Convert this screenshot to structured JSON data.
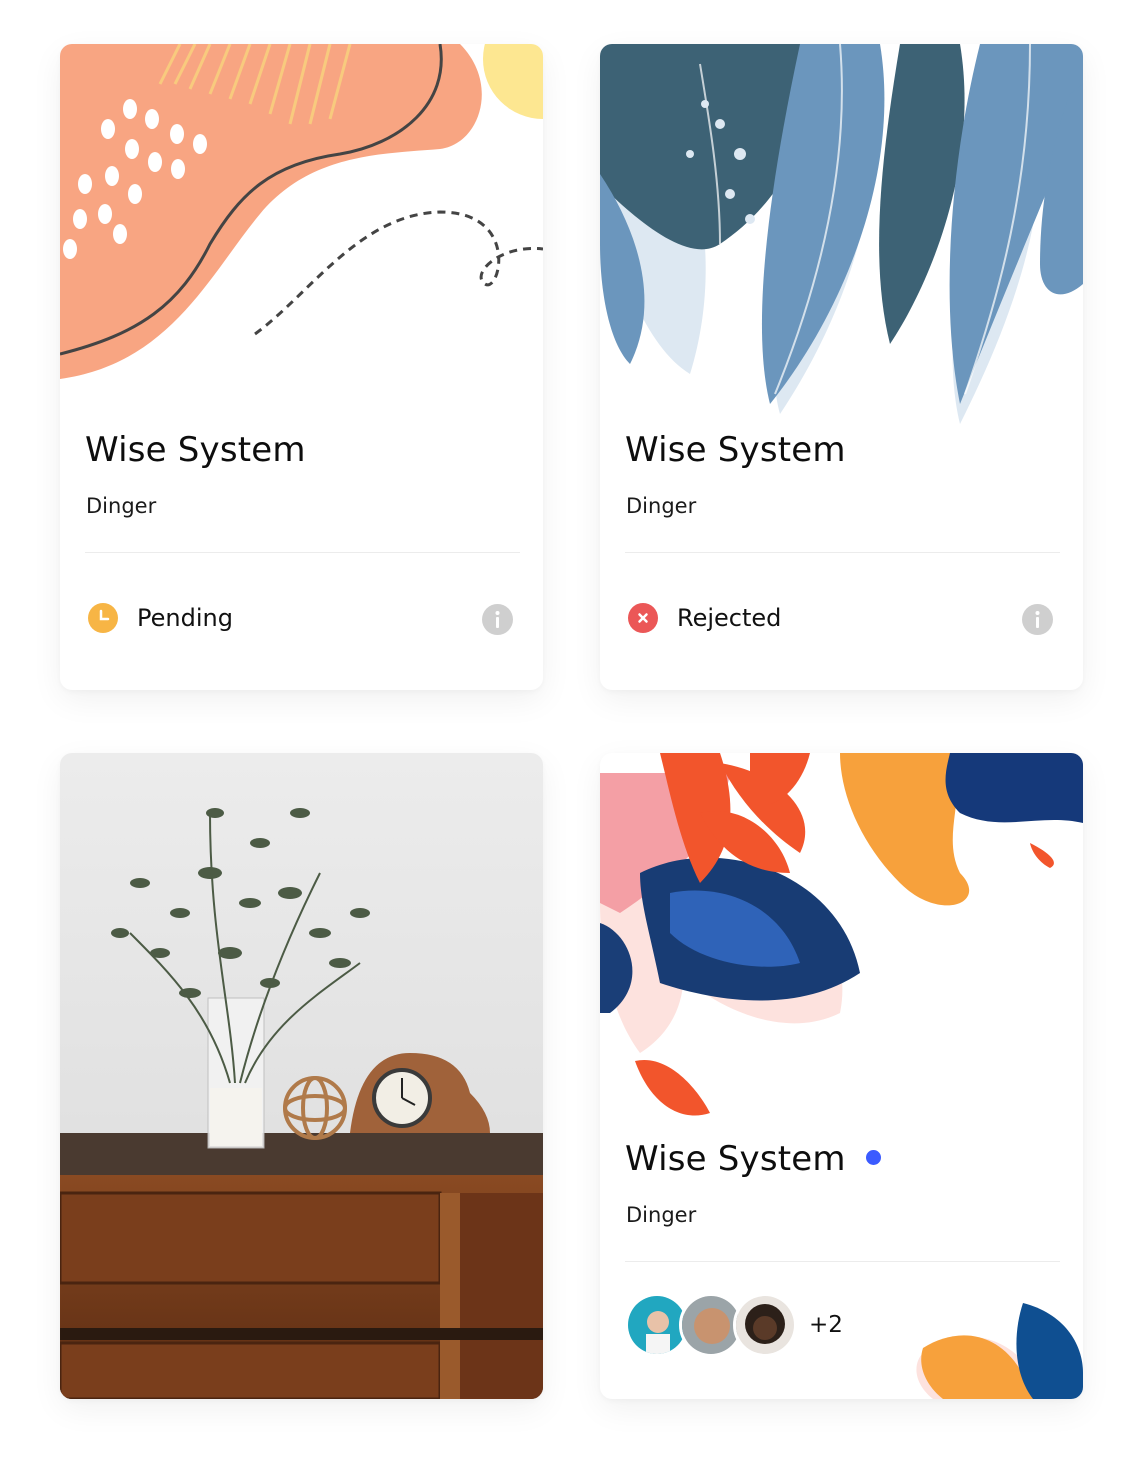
{
  "cards": [
    {
      "title": "Wise System",
      "subtitle": "Dinger",
      "status": {
        "label": "Pending",
        "icon": "clock-icon",
        "color": "#F7B545"
      }
    },
    {
      "title": "Wise System",
      "subtitle": "Dinger",
      "status": {
        "label": "Rejected",
        "icon": "close-circle-icon",
        "color": "#EB5757"
      }
    },
    {
      "image": "vase-clock-photo"
    },
    {
      "title": "Wise System",
      "subtitle": "Dinger",
      "dot_color": "#3B5BFF",
      "members": [
        "avatar-1",
        "avatar-2",
        "avatar-3"
      ],
      "more_count": "+2"
    }
  ],
  "colors": {
    "info_icon": "#CFCFCF"
  }
}
